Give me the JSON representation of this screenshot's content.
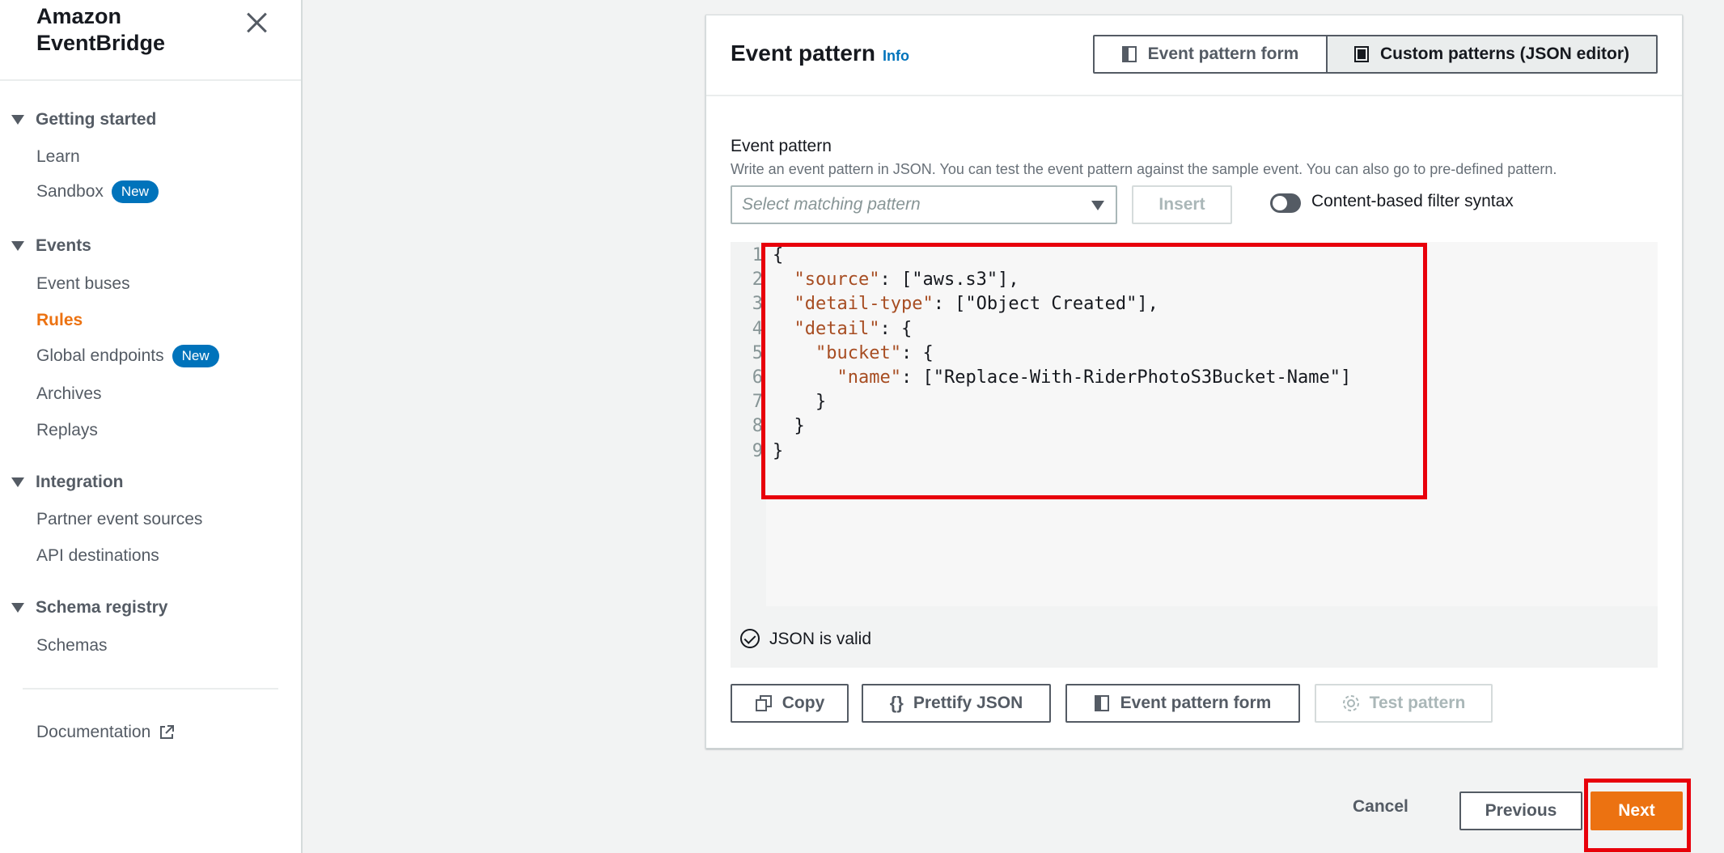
{
  "sidebar": {
    "brand": "Amazon\nEventBridge",
    "sections": [
      {
        "label": "Getting started",
        "items": [
          {
            "label": "Learn"
          },
          {
            "label": "Sandbox",
            "badge": "New"
          }
        ]
      },
      {
        "label": "Events",
        "items": [
          {
            "label": "Event buses"
          },
          {
            "label": "Rules",
            "active": true
          },
          {
            "label": "Global endpoints",
            "badge": "New"
          },
          {
            "label": "Archives"
          },
          {
            "label": "Replays"
          }
        ]
      },
      {
        "label": "Integration",
        "items": [
          {
            "label": "Partner event sources"
          },
          {
            "label": "API destinations"
          }
        ]
      },
      {
        "label": "Schema registry",
        "items": [
          {
            "label": "Schemas"
          }
        ]
      }
    ],
    "documentation": "Documentation"
  },
  "panel": {
    "title": "Event pattern",
    "info": "Info",
    "segments": {
      "form": "Event pattern form",
      "json": "Custom patterns (JSON editor)"
    },
    "field_label": "Event pattern",
    "field_desc": "Write an event pattern in JSON. You can test the event pattern against the sample event. You can also go to pre-defined pattern.",
    "select_placeholder": "Select matching pattern",
    "insert": "Insert",
    "toggle_label": "Content-based filter syntax",
    "code_lines": [
      "{",
      "  \"source\": [\"aws.s3\"],",
      "  \"detail-type\": [\"Object Created\"],",
      "  \"detail\": {",
      "    \"bucket\": {",
      "      \"name\": [\"Replace-With-RiderPhotoS3Bucket-Name\"]",
      "    }",
      "  }",
      "}"
    ],
    "line_numbers": [
      "1",
      "2",
      "3",
      "4",
      "5",
      "6",
      "7",
      "8",
      "9"
    ],
    "valid_text": "JSON is valid",
    "actions": {
      "copy": "Copy",
      "prettify": "Prettify JSON",
      "form": "Event pattern form",
      "test": "Test pattern"
    }
  },
  "footer": {
    "cancel": "Cancel",
    "previous": "Previous",
    "next": "Next"
  },
  "colors": {
    "accent": "#ec7211",
    "link": "#0073bb",
    "highlight": "#e8000b",
    "json_key": "#a74d22"
  }
}
